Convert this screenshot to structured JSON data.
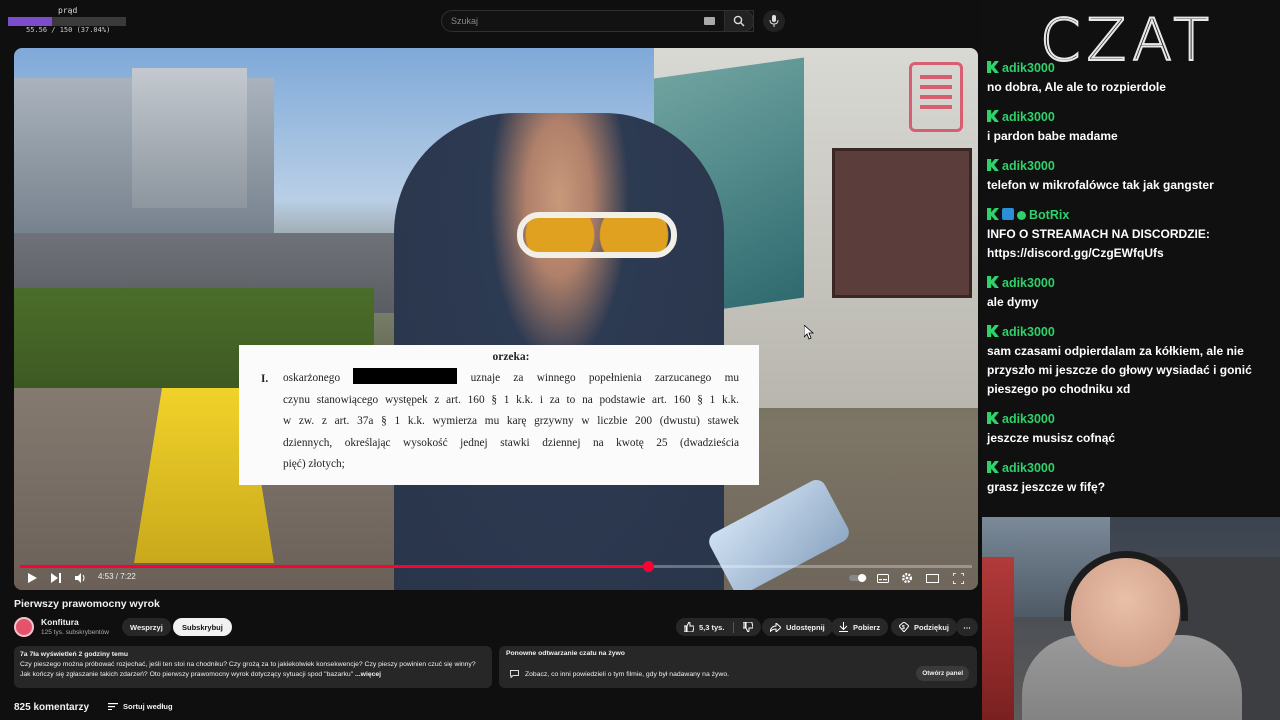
{
  "overlay": {
    "power_label": "prąd",
    "power_readout": "55.56 / 150 (37.04%)",
    "power_fraction": 0.3704
  },
  "search": {
    "placeholder": "Szukaj"
  },
  "video": {
    "title": "Pierwszy prawomocny wyrok",
    "time": "4:53 / 7:22",
    "progress_fraction": 0.66,
    "document": {
      "heading": "orzeka:",
      "item_number": "I.",
      "line1_before": "oskarżonego",
      "line1_after": "uznaje za winnego popełnienia zarzucanego mu",
      "line2": "czynu stanowiącego występek z art. 160 § 1 k.k. i za to na podstawie art. 160 § 1 k.k.",
      "line3": "w zw. z art. 37a § 1 k.k. wymierza mu karę grzywny w liczbie 200 (dwustu) stawek",
      "line4": "dziennych, określając wysokość jednej stawki dziennej na kwotę 25 (dwadzieścia",
      "line5": "pięć) złotych;"
    }
  },
  "channel": {
    "name": "Konfitura",
    "subscribers": "125 tys. subskrybentów",
    "support_label": "Wesprzyj",
    "subscribe_label": "Subskrybuj"
  },
  "actions": {
    "likes": "5,3 tys.",
    "share": "Udostępnij",
    "download": "Pobierz",
    "thanks": "Podziękuj"
  },
  "description": {
    "meta": "7a 7ła wyświetleń  2 godziny temu",
    "text": "Czy pieszego można próbować rozjechać, jeśli ten stoi na chodniku? Czy grożą za to jakiekolwiek konsekwencje? Czy pieszy powinien czuć się winny? Jak kończy się zgłaszanie takich zdarzeń? Oto pierwszy prawomocny wyrok dotyczący sytuacji spod \"bazarku\"",
    "more": "...więcej"
  },
  "replay": {
    "title": "Ponowne odtwarzanie czatu na żywo",
    "subtitle": "Zobacz, co inni powiedzieli o tym filmie, gdy był nadawany na żywo.",
    "button": "Otwórz panel"
  },
  "comments": {
    "count": "825 komentarzy",
    "sort": "Sortuj według"
  },
  "chat": {
    "logo": "CZAT",
    "messages": [
      {
        "user": "adik3000",
        "text": "no dobra, Ale ale to rozpierdole"
      },
      {
        "user": "adik3000",
        "text": "i pardon babe madame"
      },
      {
        "user": "adik3000",
        "text": "telefon w mikrofalówce tak jak gangster"
      },
      {
        "user": "BotRix",
        "text": "INFO O STREAMACH NA DISCORDZIE:",
        "text2": "https://discord.gg/CzgEWfqUfs"
      },
      {
        "user": "adik3000",
        "text": "ale dymy"
      },
      {
        "user": "adik3000",
        "text": "sam czasami odpierdalam za kółkiem, ale nie",
        "text2": "przyszło mi jeszcze do głowy wysiadać i gonić",
        "text3": "pieszego po chodniku xd"
      },
      {
        "user": "adik3000",
        "text": "jeszcze musisz cofnąć"
      },
      {
        "user": "adik3000",
        "text": "grasz jeszcze w fifę?"
      }
    ]
  },
  "colors": {
    "accent_red": "#ff0033",
    "chat_username": "#2fd16b",
    "power_fill": "#7b4dcc"
  }
}
